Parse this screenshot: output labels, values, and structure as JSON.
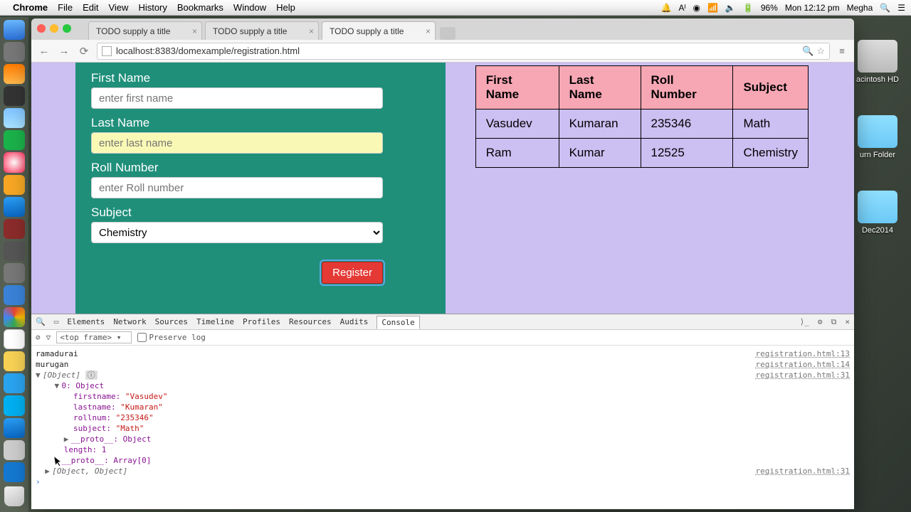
{
  "menubar": {
    "apple": "",
    "app": "Chrome",
    "items": [
      "File",
      "Edit",
      "View",
      "History",
      "Bookmarks",
      "Window",
      "Help"
    ],
    "right": [
      "🔔",
      "Aᴵ",
      "◉",
      "📶",
      "🔈",
      "🔋",
      "96%",
      "Mon 12:12 pm",
      "Megha",
      "🔍",
      "☰"
    ]
  },
  "desktop": {
    "hd_label": "acintosh HD",
    "burn_label": "urn Folder",
    "dec_label": "Dec2014"
  },
  "tabs": {
    "t1": "TODO supply a title",
    "t2": "TODO supply a title",
    "t3": "TODO supply a title"
  },
  "omnibox": {
    "url": "localhost:8383/domexample/registration.html"
  },
  "form": {
    "firstname_label": "First Name",
    "firstname_ph": "enter first name",
    "lastname_label": "Last Name",
    "lastname_ph": "enter last name",
    "roll_label": "Roll Number",
    "roll_ph": "enter Roll number",
    "subject_label": "Subject",
    "subject_value": "Chemistry",
    "register": "Register"
  },
  "table": {
    "h1": "First Name",
    "h2": "Last Name",
    "h3": "Roll Number",
    "h4": "Subject",
    "rows": [
      {
        "c1": "Vasudev",
        "c2": "Kumaran",
        "c3": "235346",
        "c4": "Math"
      },
      {
        "c1": "Ram",
        "c2": "Kumar",
        "c3": "12525",
        "c4": "Chemistry"
      }
    ]
  },
  "devtools": {
    "tabs": [
      "Elements",
      "Network",
      "Sources",
      "Timeline",
      "Profiles",
      "Resources",
      "Audits",
      "Console"
    ],
    "frame": "<top frame>",
    "preserve": "Preserve log",
    "lines": {
      "l1": "ramadurai",
      "l2": "murugan",
      "obj": "[Object]",
      "zero": "0: Object",
      "fn": "firstname: ",
      "fnv": "\"Vasudev\"",
      "ln": "lastname: ",
      "lnv": "\"Kumaran\"",
      "rn": "rollnum: ",
      "rnv": "\"235346\"",
      "sb": "subject: ",
      "sbv": "\"Math\"",
      "proto": "__proto__: Object",
      "len": "length: 1",
      "proto2": "__proto__: Array[0]",
      "oo": "[Object, Object]",
      "src": "registration.html:13",
      "src2": "registration.html:14",
      "src3": "registration.html:31"
    }
  }
}
